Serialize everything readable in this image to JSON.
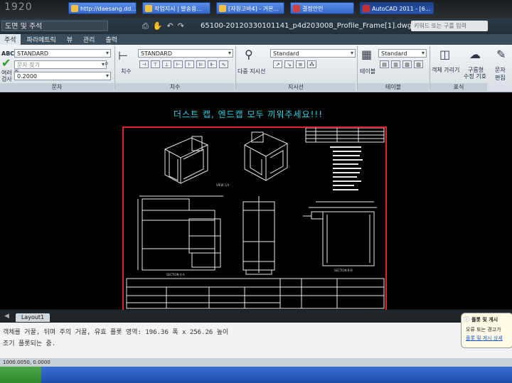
{
  "bezel": {
    "brand": "1920"
  },
  "titlebar": {
    "workspace": "도면 및 주석",
    "document_title": "65100-20120330101141_p4d203008_Profile_Frame[1].dwg",
    "search_placeholder": "키워드 또는 구를 입력"
  },
  "ribbon_tabs": [
    "주석",
    "파라메트릭",
    "뷰",
    "관리",
    "출력"
  ],
  "ribbon": {
    "text_panel": {
      "abc": "ABC",
      "style": "STANDARD",
      "find_placeholder": "문자 찾기",
      "height": "0.2000",
      "big_label_1": "여러 줄",
      "big_label_2": "문자",
      "spell": "검사",
      "label": "문자"
    },
    "dim_panel": {
      "style": "STANDARD",
      "big_label": "치수",
      "label": "치수"
    },
    "leader_panel": {
      "style": "Standard",
      "big_label": "다중 지시선",
      "label": "지시선"
    },
    "table_panel": {
      "style": "Standard",
      "big_label": "테이블",
      "label": "테이블"
    },
    "markup_panel": {
      "btn1": "객체 가리기",
      "btn2a": "구름형",
      "btn2b": "수정 기호",
      "btn3": "문자 편집",
      "label": "표식"
    }
  },
  "drawing": {
    "banner": "더스트 캡, 엔드캡 모두 끼워주세요!!!",
    "view_labels": [
      "VIEW 1/4",
      "SECTION A-A",
      "SECTION B-B"
    ]
  },
  "layout_tab": "Layout1",
  "command_lines": [
    "객체를 거꿀, 뒤며 주의 거꿀, 유효 플롯 영역: 196.36 폭 x 256.26 높이",
    "조기 플롯되는 중."
  ],
  "balloon": {
    "title": "플롯 및 게시",
    "line1": "오류 또는 경고가",
    "line2": "플롯 및 게시 상세"
  },
  "statusbar": {
    "coords": "1000.0050, 0.0000"
  },
  "taskbar": {
    "items": [
      "http://daesang.dd...",
      "작업지시 | 발송용...",
      "[자원고바4] - 거본...",
      "결정안인",
      "AutoCAD 2011 - [6..."
    ]
  },
  "colors": {
    "banner": "#1fd5ea",
    "sheet_border": "#e1262a",
    "taskbar": "#2a5bbf"
  }
}
